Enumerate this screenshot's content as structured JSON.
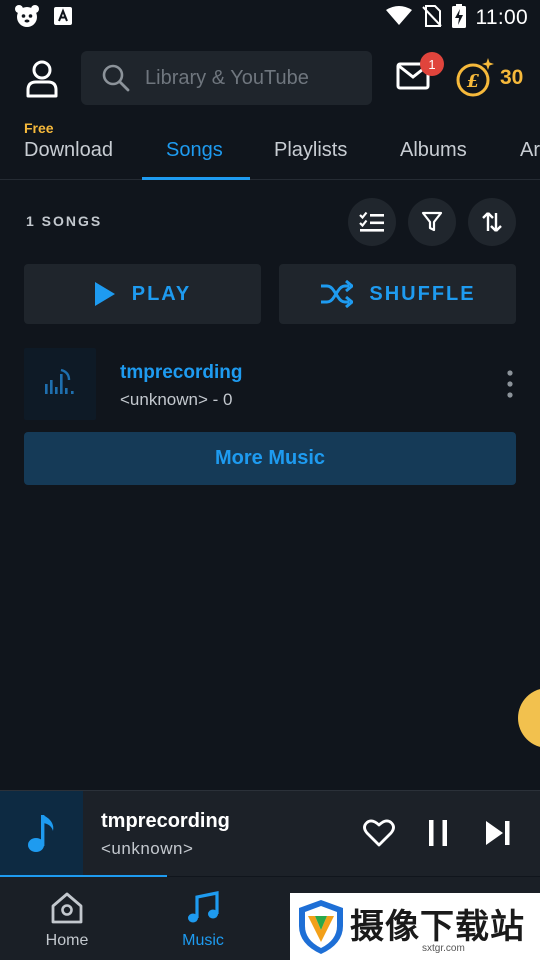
{
  "status_bar": {
    "time": "11:00",
    "icons": [
      "pet-face-icon",
      "font-a-icon",
      "wifi-icon",
      "no-sim-icon",
      "battery-charging-icon"
    ]
  },
  "header": {
    "search_placeholder": "Library & YouTube",
    "mail_badge": "1",
    "coin_count": "30"
  },
  "tabs": [
    {
      "label": "Download",
      "tag": "Free",
      "active": false
    },
    {
      "label": "Songs",
      "active": true
    },
    {
      "label": "Playlists",
      "active": false
    },
    {
      "label": "Albums",
      "active": false
    },
    {
      "label": "Ar",
      "active": false
    }
  ],
  "songs_section": {
    "count_label": "1 SONGS",
    "play_label": "PLAY",
    "shuffle_label": "SHUFFLE",
    "more_music_label": "More Music"
  },
  "songs": [
    {
      "title": "tmprecording",
      "subtitle": "<unknown> - 0"
    }
  ],
  "mini_player": {
    "title": "tmprecording",
    "artist": "<unknown>",
    "progress_fraction": 0.31
  },
  "bottom_nav": [
    {
      "label": "Home",
      "active": false
    },
    {
      "label": "Music",
      "active": true
    }
  ],
  "watermark": {
    "text": "摄像下载站",
    "url": "sxtgr.com"
  },
  "colors": {
    "accent": "#1e9bf0",
    "background": "#10151c",
    "coin": "#f6b93b",
    "badge": "#e0443c"
  }
}
